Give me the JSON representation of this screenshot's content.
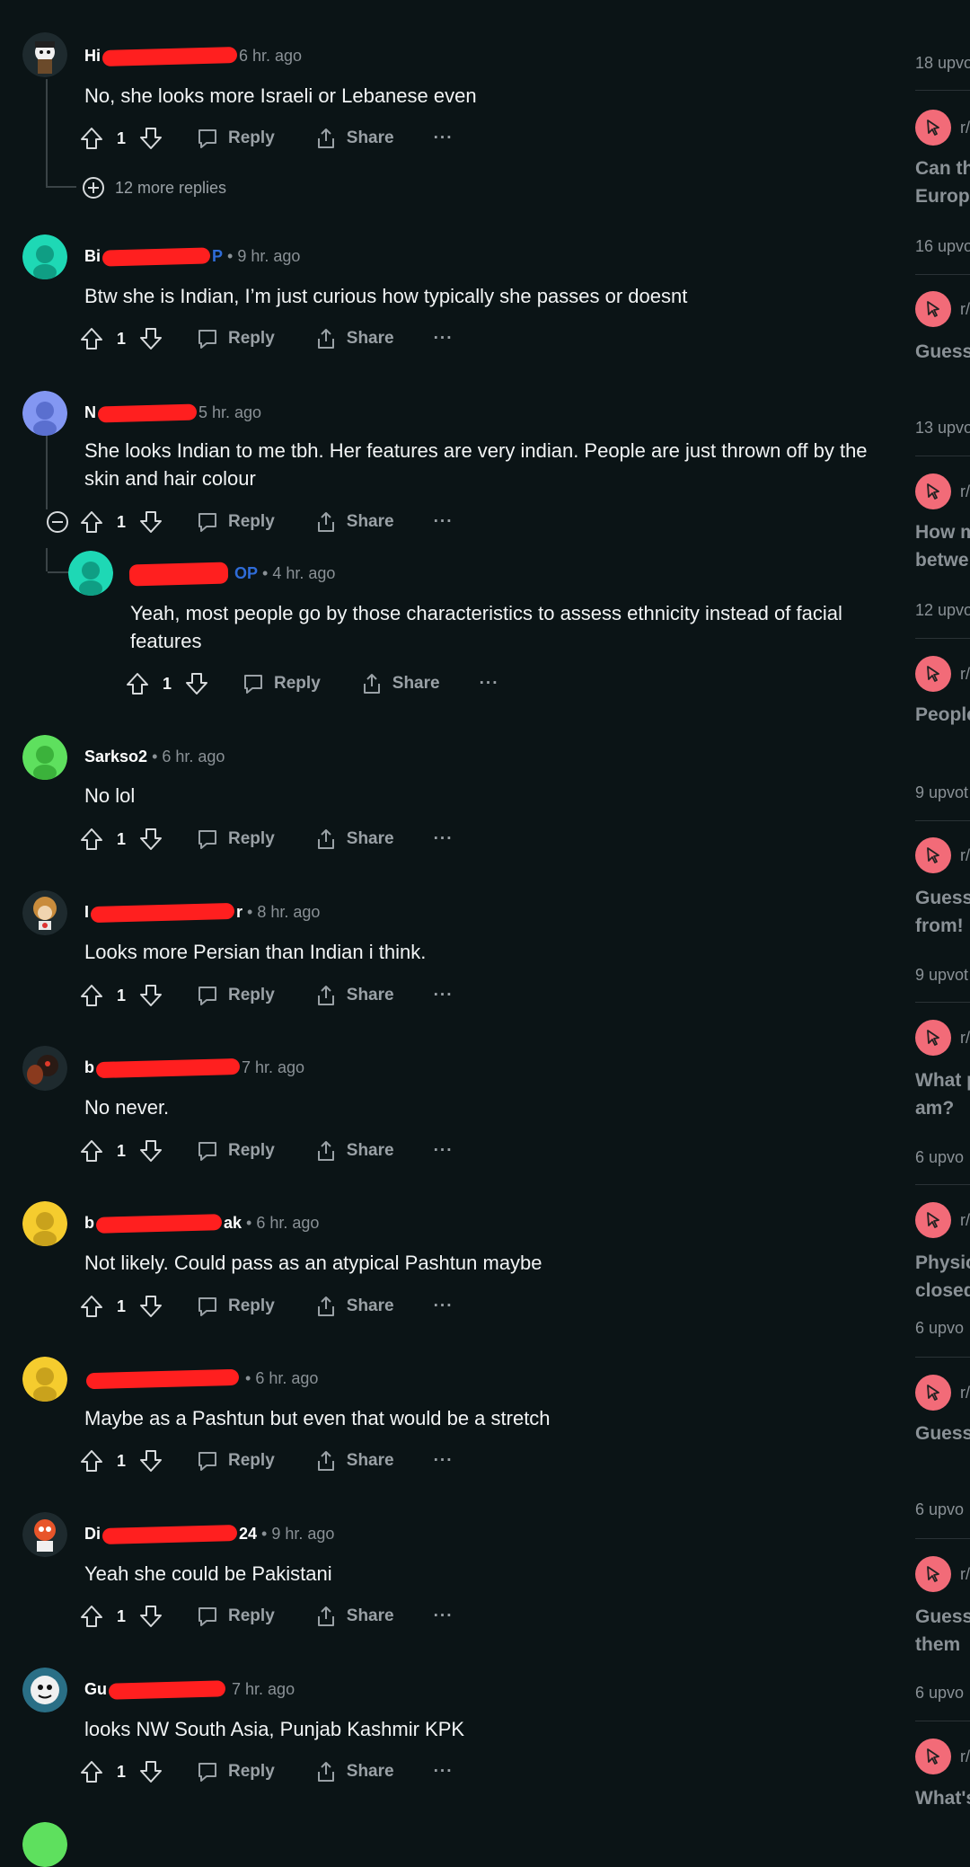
{
  "actions": {
    "reply": "Reply",
    "share": "Share",
    "more": "···"
  },
  "op_label": "OP",
  "comments": [
    {
      "author_prefix": "Hi",
      "author_suffix": "",
      "time": "6 hr. ago",
      "text": "No, she looks more Israeli or Lebanese even",
      "votes": "1",
      "more_replies": "12 more replies"
    },
    {
      "author_prefix": "Bi",
      "author_suffix": "",
      "op": "P",
      "time": "9 hr. ago",
      "text": "Btw she is Indian, I’m just curious how typically she passes or doesnt",
      "votes": "1"
    },
    {
      "author_prefix": "N",
      "author_suffix": "",
      "time": "5 hr. ago",
      "text": "She looks Indian to me tbh. Her features are very indian. People are just thrown off by the skin and hair colour",
      "votes": "1"
    },
    {
      "author_prefix": "",
      "author_suffix": "",
      "op": "OP",
      "time": "4 hr. ago",
      "text": "Yeah, most people go by those characteristics to assess ethnicity instead of facial features",
      "votes": "1"
    },
    {
      "author_prefix": "Sarkso2",
      "author_suffix": "",
      "time": "6 hr. ago",
      "text": "No lol",
      "votes": "1"
    },
    {
      "author_prefix": "I",
      "author_suffix": "r",
      "time": "8 hr. ago",
      "text": "Looks more Persian than Indian i think.",
      "votes": "1"
    },
    {
      "author_prefix": "b",
      "author_suffix": "",
      "time": "7 hr. ago",
      "text": "No never.",
      "votes": "1"
    },
    {
      "author_prefix": "b",
      "author_suffix": "ak",
      "time": "6 hr. ago",
      "text": "Not likely. Could pass as an atypical Pashtun maybe",
      "votes": "1"
    },
    {
      "author_prefix": "",
      "author_suffix": "",
      "time": "6 hr. ago",
      "text": "Maybe as a Pashtun but even that would be a stretch",
      "votes": "1"
    },
    {
      "author_prefix": "Di",
      "author_suffix": "24",
      "time": "9 hr. ago",
      "text": "Yeah she could be Pakistani",
      "votes": "1"
    },
    {
      "author_prefix": "Gu",
      "author_suffix": "",
      "time": "7 hr. ago",
      "text": "looks NW South Asia, Punjab Kashmir KPK",
      "votes": "1"
    }
  ],
  "sidebar": {
    "sub_prefix": "r/",
    "items": [
      {
        "upvotes": "18 upvo"
      },
      {
        "title": "Can th\nEurope",
        "upvotes": "16 upvo"
      },
      {
        "title": "Guess",
        "upvotes": "13 upvo"
      },
      {
        "title": "How m\nbetwe",
        "upvotes": "12 upvo"
      },
      {
        "title": "People",
        "upvotes": "9 upvot"
      },
      {
        "title": "Guess\nfrom!",
        "upvotes": "9 upvot"
      },
      {
        "title": "What p\nam?",
        "upvotes": "6 upvo"
      },
      {
        "title": "Physic\nclosed",
        "upvotes": "6 upvo"
      },
      {
        "title": "Guess",
        "upvotes": "6 upvo"
      },
      {
        "title": "Guess\nthem",
        "upvotes": "6 upvo"
      },
      {
        "title": "What's",
        "upvotes": ""
      }
    ]
  },
  "colors": {
    "background": "#0b1416",
    "redaction": "#ff1f1f",
    "op": "#2f6cd8",
    "sidebar_icon": "#f26b78"
  }
}
